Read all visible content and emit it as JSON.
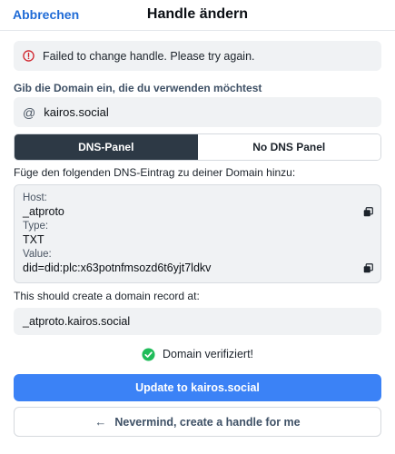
{
  "header": {
    "cancel_label": "Abbrechen",
    "title": "Handle ändern"
  },
  "error": {
    "icon": "error-circle-icon",
    "message": "Failed to change handle. Please try again."
  },
  "domain": {
    "label": "Gib die Domain ein, die du verwenden möchtest",
    "prefix_symbol": "@",
    "value": "kairos.social"
  },
  "tabs": [
    {
      "label": "DNS-Panel",
      "active": true
    },
    {
      "label": "No DNS Panel",
      "active": false
    }
  ],
  "instruction": "Füge den folgenden DNS-Eintrag zu deiner Domain hinzu:",
  "record": {
    "host_label": "Host:",
    "host_value": "_atproto",
    "type_label": "Type:",
    "type_value": "TXT",
    "value_label": "Value:",
    "value_value": "did=did:plc:x63potnfmsozd6t6yjt7ldkv"
  },
  "create_text": "This should create a domain record at:",
  "result_domain": "_atproto.kairos.social",
  "verified_text": "Domain verifiziert!",
  "primary_button": "Update to kairos.social",
  "secondary_button": "Nevermind, create a handle for me",
  "colors": {
    "accent": "#1f6bd6",
    "primary_button": "#3b82f6",
    "active_tab": "#2d3945",
    "error_icon": "#d0242c",
    "success": "#20bc5a"
  }
}
